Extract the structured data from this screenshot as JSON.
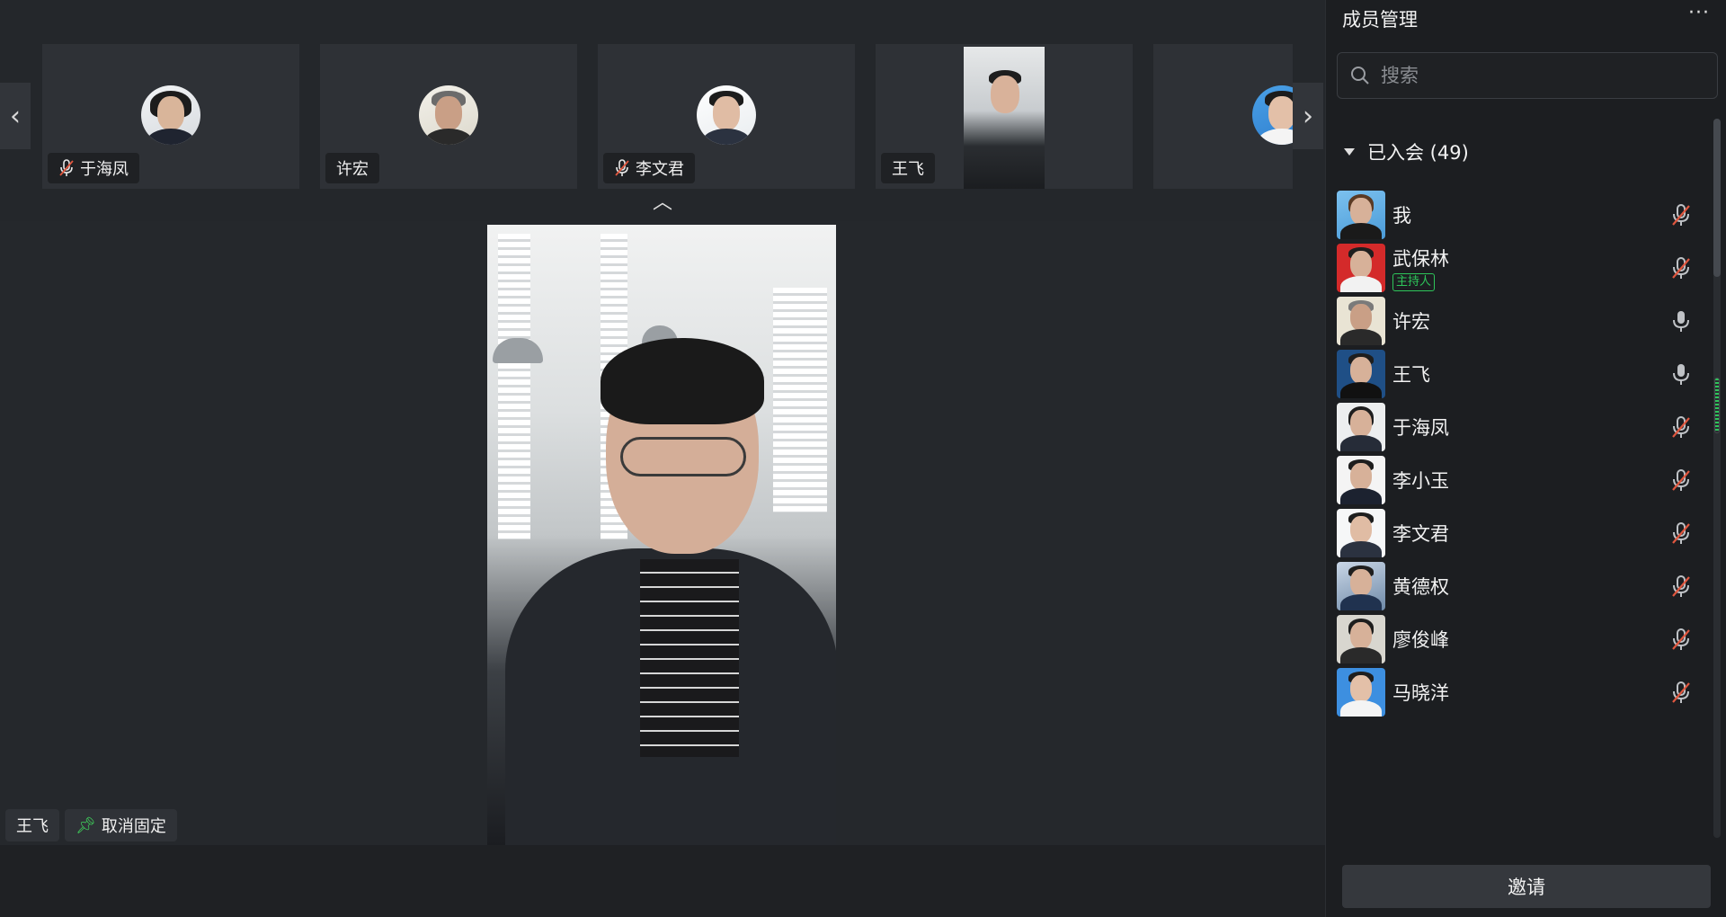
{
  "strip": {
    "tiles": [
      {
        "name": "于海凤",
        "muted": true
      },
      {
        "name": "许宏",
        "muted": false
      },
      {
        "name": "李文君",
        "muted": true
      },
      {
        "name": "王飞",
        "muted": false
      }
    ]
  },
  "main": {
    "speaker_name": "王飞",
    "unpin_label": "取消固定"
  },
  "panel": {
    "title": "成员管理",
    "more": "···",
    "search_placeholder": "搜索",
    "group_label": "已入会 (49)",
    "host_badge": "主持人",
    "members": [
      {
        "name": "我",
        "mic": "muted",
        "host": false
      },
      {
        "name": "武保林",
        "mic": "muted",
        "host": true
      },
      {
        "name": "许宏",
        "mic": "on",
        "host": false
      },
      {
        "name": "王飞",
        "mic": "on",
        "host": false
      },
      {
        "name": "于海凤",
        "mic": "muted",
        "host": false
      },
      {
        "name": "李小玉",
        "mic": "muted",
        "host": false
      },
      {
        "name": "李文君",
        "mic": "muted",
        "host": false
      },
      {
        "name": "黄德权",
        "mic": "muted",
        "host": false
      },
      {
        "name": "廖俊峰",
        "mic": "muted",
        "host": false
      },
      {
        "name": "马晓洋",
        "mic": "muted",
        "host": false
      }
    ],
    "invite_label": "邀请"
  },
  "icons": {
    "nav_left": "chevron-left-icon",
    "nav_right": "chevron-right-icon",
    "collapse": "chevron-up-icon",
    "mic_on": "mic-icon",
    "mic_off": "mic-off-icon",
    "pin": "pin-icon",
    "search": "search-icon"
  },
  "colors": {
    "accent_green": "#2ec55a",
    "muted_red": "#e0573f"
  }
}
